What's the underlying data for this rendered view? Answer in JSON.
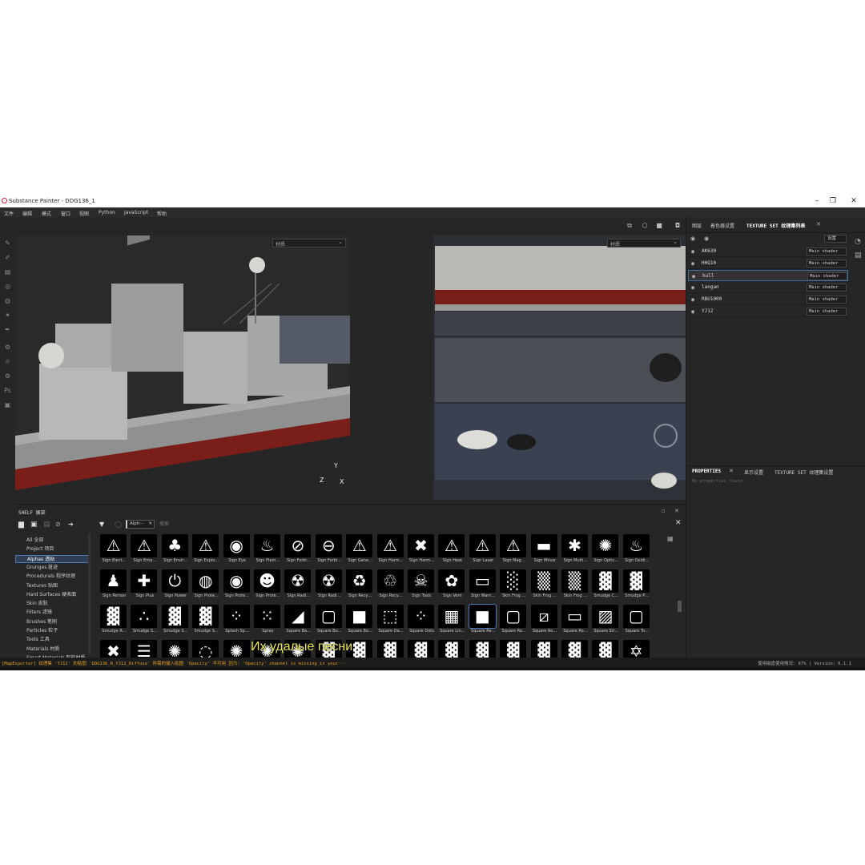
{
  "window": {
    "title": "Substance Painter - DDG136_1",
    "minimize": "–",
    "maximize": "❐",
    "close": "✕"
  },
  "menu": [
    "文件",
    "编辑",
    "模式",
    "窗口",
    "视图",
    "Python",
    "JavaScript",
    "帮助"
  ],
  "viewport": {
    "left_mode": "材质",
    "right_mode": "材质",
    "axis_y": "Y",
    "axis_z": "Z",
    "axis_x": "X"
  },
  "right_panel": {
    "tabs": [
      "图层",
      "着色器设置",
      "TEXTURE SET 纹理集列表"
    ],
    "settings_label": "设置",
    "texture_sets": [
      {
        "name": "AK630",
        "shader": "Main shader"
      },
      {
        "name": "HHQ10",
        "shader": "Main shader"
      },
      {
        "name": "hull",
        "shader": "Main shader"
      },
      {
        "name": "langan",
        "shader": "Main shader"
      },
      {
        "name": "RBU1000",
        "shader": "Main shader"
      },
      {
        "name": "YJ12",
        "shader": "Main shader"
      }
    ],
    "props_tabs": [
      "PROPERTIES",
      "显示设置",
      "TEXTURE SET 纹理集设置"
    ],
    "props_empty": "No properties found"
  },
  "shelf": {
    "title": "SHELF 展架",
    "filter_tag": "Alph···",
    "search_placeholder": "搜索",
    "categories": [
      "All 全部",
      "Project 项目",
      "Alphas 透贴",
      "Grunges 脏迹",
      "Procedurals 程序纹理",
      "Textures 贴图",
      "Hard Surfaces 硬表面",
      "Skin 皮肤",
      "Filters 滤镜",
      "Brushes 笔刷",
      "Particles 粒子",
      "Tools 工具",
      "Materials 材质",
      "Smart Materials 智能材质"
    ],
    "active_category": 2,
    "items": [
      {
        "label": "Sign Elect…",
        "glyph": "⚠"
      },
      {
        "label": "Sign Enta…",
        "glyph": "⚠"
      },
      {
        "label": "Sign Envir…",
        "glyph": "♣"
      },
      {
        "label": "Sign Explo…",
        "glyph": "⚠"
      },
      {
        "label": "Sign Eye",
        "glyph": "◉"
      },
      {
        "label": "Sign Flam…",
        "glyph": "♨"
      },
      {
        "label": "Sign Forbi…",
        "glyph": "⊘"
      },
      {
        "label": "Sign Forbi…",
        "glyph": "⊖"
      },
      {
        "label": "Sign Gene…",
        "glyph": "⚠"
      },
      {
        "label": "Sign Harm…",
        "glyph": "⚠"
      },
      {
        "label": "Sign Harm…",
        "glyph": "✖"
      },
      {
        "label": "Sign Heat",
        "glyph": "⚠"
      },
      {
        "label": "Sign Laser",
        "glyph": "⚠"
      },
      {
        "label": "Sign Mag…",
        "glyph": "⚠"
      },
      {
        "label": "Sign Minus",
        "glyph": "▬"
      },
      {
        "label": "Sign Multi…",
        "glyph": "✱"
      },
      {
        "label": "Sign Optic…",
        "glyph": "✺"
      },
      {
        "label": "Sign Oxidi…",
        "glyph": "♨"
      },
      {
        "label": "Sign Person",
        "glyph": "♟"
      },
      {
        "label": "Sign Plus",
        "glyph": "✚"
      },
      {
        "label": "Sign Power",
        "glyph": "⏻"
      },
      {
        "label": "Sign Prote…",
        "glyph": "◍"
      },
      {
        "label": "Sign Prote…",
        "glyph": "◉"
      },
      {
        "label": "Sign Prote…",
        "glyph": "☻"
      },
      {
        "label": "Sign Radi…",
        "glyph": "☢"
      },
      {
        "label": "Sign Radi…",
        "glyph": "☢"
      },
      {
        "label": "Sign Recy…",
        "glyph": "♻"
      },
      {
        "label": "Sign Recy…",
        "glyph": "♲"
      },
      {
        "label": "Sign Toxic",
        "glyph": "☠"
      },
      {
        "label": "Sign Vent",
        "glyph": "✿"
      },
      {
        "label": "Sign Warn…",
        "glyph": "▭"
      },
      {
        "label": "Skin Frog …",
        "glyph": "░"
      },
      {
        "label": "Skin Frog …",
        "glyph": "▒"
      },
      {
        "label": "Skin Frog …",
        "glyph": "▒"
      },
      {
        "label": "Smudge C…",
        "glyph": "▓"
      },
      {
        "label": "Smudge P…",
        "glyph": "▓"
      },
      {
        "label": "Smudge R…",
        "glyph": "▓"
      },
      {
        "label": "Smudge S…",
        "glyph": "∴"
      },
      {
        "label": "Smudge S…",
        "glyph": "▓"
      },
      {
        "label": "Smudge S…",
        "glyph": "▓"
      },
      {
        "label": "Splash Sp…",
        "glyph": "⁘"
      },
      {
        "label": "Spray",
        "glyph": "⁙"
      },
      {
        "label": "Square Ba…",
        "glyph": "◢"
      },
      {
        "label": "Square Bo…",
        "glyph": "▢"
      },
      {
        "label": "Square Bo…",
        "glyph": "■"
      },
      {
        "label": "Square Da…",
        "glyph": "⬚"
      },
      {
        "label": "Square Dots",
        "glyph": "⁘"
      },
      {
        "label": "Square Lin…",
        "glyph": "▦"
      },
      {
        "label": "Square Re…",
        "glyph": "■"
      },
      {
        "label": "Square Ro…",
        "glyph": "▢"
      },
      {
        "label": "Square Ro…",
        "glyph": "⧄"
      },
      {
        "label": "Square Ro…",
        "glyph": "▭"
      },
      {
        "label": "Square Str…",
        "glyph": "▨"
      },
      {
        "label": "Square To…",
        "glyph": "▢"
      },
      {
        "label": "",
        "glyph": "✖"
      },
      {
        "label": "",
        "glyph": "☰"
      },
      {
        "label": "",
        "glyph": "✺"
      },
      {
        "label": "",
        "glyph": "◌"
      },
      {
        "label": "",
        "glyph": "✺"
      },
      {
        "label": "",
        "glyph": "✺"
      },
      {
        "label": "",
        "glyph": "✺"
      },
      {
        "label": "",
        "glyph": "▓"
      },
      {
        "label": "",
        "glyph": "▓"
      },
      {
        "label": "",
        "glyph": "▓"
      },
      {
        "label": "",
        "glyph": "▓"
      },
      {
        "label": "",
        "glyph": "▓"
      },
      {
        "label": "",
        "glyph": "▓"
      },
      {
        "label": "",
        "glyph": "▓"
      },
      {
        "label": "",
        "glyph": "▓"
      },
      {
        "label": "",
        "glyph": "▓"
      },
      {
        "label": "",
        "glyph": "▓"
      },
      {
        "label": "",
        "glyph": "✡"
      }
    ]
  },
  "subtitle": "Их удалые песни",
  "status": {
    "message": "[MapExporter] 纹理集 'YJ12' 的贴图 'DDG136_R_YJ12_Diffuse' 所需的输入贴图 'Opacity' 不可用 因为: 'Opacity' channel is missing in your···",
    "memory": "使用磁盘使用情况: 67% | Version: 6.1.1"
  }
}
